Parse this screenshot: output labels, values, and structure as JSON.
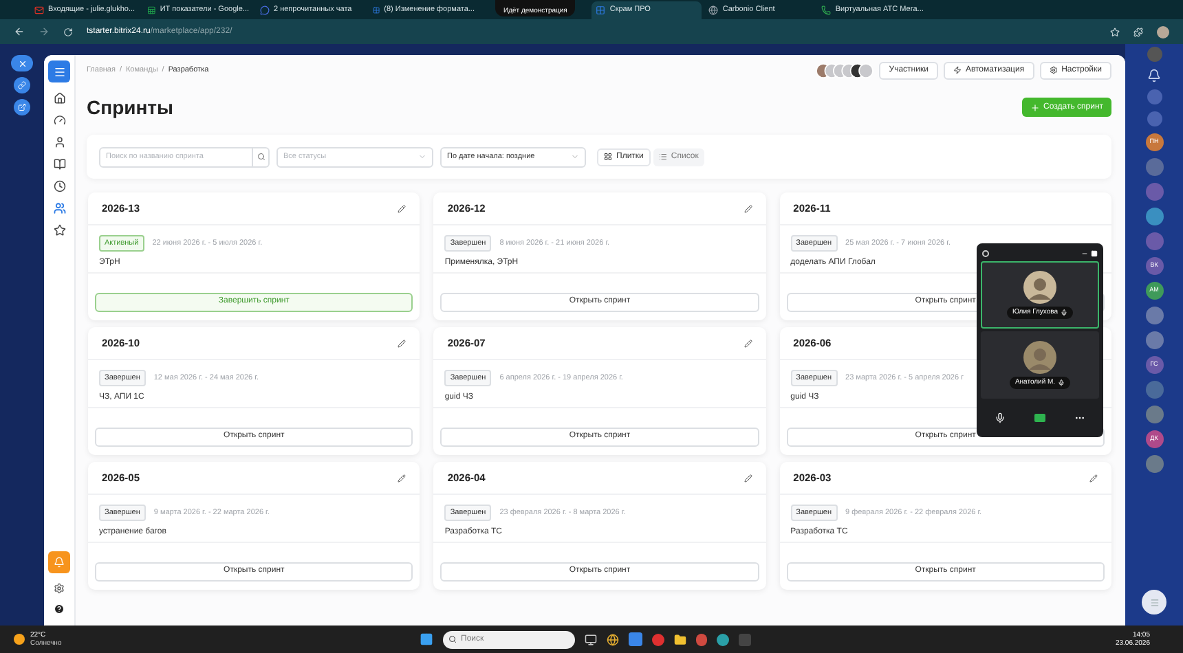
{
  "browser": {
    "tabs": [
      {
        "title": "Входящие - julie.glukho...",
        "kind": "mail",
        "selected": false
      },
      {
        "title": "ИТ показатели - Google...",
        "kind": "sheet",
        "selected": false
      },
      {
        "title": "2 непрочитанных чата",
        "kind": "chat",
        "selected": false
      },
      {
        "title": "(8) Изменение формата...",
        "kind": "bitrix",
        "selected": false
      },
      {
        "title": "Скрам ПРО",
        "kind": "bitrix",
        "selected": true
      },
      {
        "title": "Carbonio Client",
        "kind": "globe",
        "selected": false
      },
      {
        "title": "Виртуальная АТС Мега...",
        "kind": "phone",
        "selected": false
      }
    ],
    "screen_share_banner": "Идёт демонстрация",
    "url_host": "tstarter.bitrix24.ru",
    "url_path": "/marketplace/app/232/"
  },
  "nav": [
    {
      "kind": "home",
      "selected": false
    },
    {
      "kind": "gauge",
      "selected": false
    },
    {
      "kind": "user",
      "selected": false
    },
    {
      "kind": "book",
      "selected": false
    },
    {
      "kind": "clock",
      "selected": false
    },
    {
      "kind": "users",
      "selected": true
    },
    {
      "kind": "star",
      "selected": false
    }
  ],
  "breadcrumbs": [
    "Главная",
    "Команды",
    "Разработка"
  ],
  "breadcrumb_separator": "/",
  "header_buttons": [
    {
      "label": "Участники",
      "kind": "plain"
    },
    {
      "label": "Автоматизация",
      "kind": "automation"
    },
    {
      "label": "Настройки",
      "kind": "settings"
    }
  ],
  "page_title": "Спринты",
  "create_button": "Создать спринт",
  "filters": {
    "search_placeholder": "Поиск по названию спринта",
    "status_placeholder": "Все статусы",
    "sort_value": "По дате начала: поздние",
    "views": [
      {
        "label": "Плитки",
        "kind": "grid",
        "selected": true
      },
      {
        "label": "Список",
        "kind": "list",
        "selected": false
      }
    ]
  },
  "sprints": [
    {
      "name": "2026-13",
      "status": "Активный",
      "kind": "active",
      "dates": "22 июня 2026 г. - 5 июля 2026 г.",
      "description": "ЭТрН",
      "action": "Завершить спринт",
      "edit_icon": true
    },
    {
      "name": "2026-12",
      "status": "Завершен",
      "kind": "done",
      "dates": "8 июня 2026 г. - 21 июня 2026 г.",
      "description": "Применялка, ЭТрН",
      "action": "Открыть спринт",
      "edit_icon": true
    },
    {
      "name": "2026-11",
      "status": "Завершен",
      "kind": "done",
      "dates": "25 мая 2026 г. - 7 июня 2026 г.",
      "description": "доделать АПИ Глобал",
      "action": "Открыть спринт"
    },
    {
      "name": "2026-10",
      "status": "Завершен",
      "kind": "done",
      "dates": "12 мая 2026 г. - 24 мая 2026 г.",
      "description": "ЧЗ, АПИ 1С",
      "action": "Открыть спринт",
      "edit_icon": true
    },
    {
      "name": "2026-07",
      "status": "Завершен",
      "kind": "done",
      "dates": "6 апреля 2026 г. - 19 апреля 2026 г.",
      "description": "guid ЧЗ",
      "action": "Открыть спринт",
      "edit_icon": true
    },
    {
      "name": "2026-06",
      "status": "Завершен",
      "kind": "done",
      "dates": "23 марта 2026 г. - 5 апреля 2026 г",
      "description": "guid ЧЗ",
      "action": "Открыть спринт"
    },
    {
      "name": "2026-05",
      "status": "Завершен",
      "kind": "done",
      "dates": "9 марта 2026 г. - 22 марта 2026 г.",
      "description": "устранение багов",
      "action": "Открыть спринт",
      "edit_icon": true
    },
    {
      "name": "2026-04",
      "status": "Завершен",
      "kind": "done",
      "dates": "23 февраля 2026 г. - 8 марта 2026 г.",
      "description": "Разработка ТС",
      "action": "Открыть спринт",
      "edit_icon": true
    },
    {
      "name": "2026-03",
      "status": "Завершен",
      "kind": "done",
      "dates": "9 февраля 2026 г. - 22 февраля 2026 г.",
      "description": "Разработка ТС",
      "action": "Открыть спринт",
      "edit_icon": true
    }
  ],
  "call": {
    "participants": [
      {
        "name": "Юлия Глухова",
        "selected": true
      },
      {
        "name": "Анатолий М.",
        "selected": false
      }
    ]
  },
  "right_avatars": [
    {
      "initials": "ПН",
      "color": "#c8783c"
    },
    {
      "color": "#5a6b9a"
    },
    {
      "color": "#6a5aa8"
    },
    {
      "color": "#3a8fc0"
    },
    {
      "color": "#6a5aa8"
    },
    {
      "initials": "ВК",
      "color": "#6a5aa8"
    },
    {
      "initials": "АМ",
      "color": "#3f9a5a"
    },
    {
      "color": "#6a7aa8"
    },
    {
      "color": "#6a7aa8"
    },
    {
      "initials": "ГС",
      "color": "#6a5aa8"
    },
    {
      "color": "#4a6a9a"
    },
    {
      "color": "#6a7a8a"
    },
    {
      "initials": "ДК",
      "color": "#b04a8a"
    },
    {
      "color": "#6a7a8a"
    }
  ],
  "taskbar": {
    "temperature": "22°C",
    "weather": "Солнечно",
    "search_placeholder": "Поиск",
    "time": "14:05",
    "date": "23.06.2026"
  }
}
